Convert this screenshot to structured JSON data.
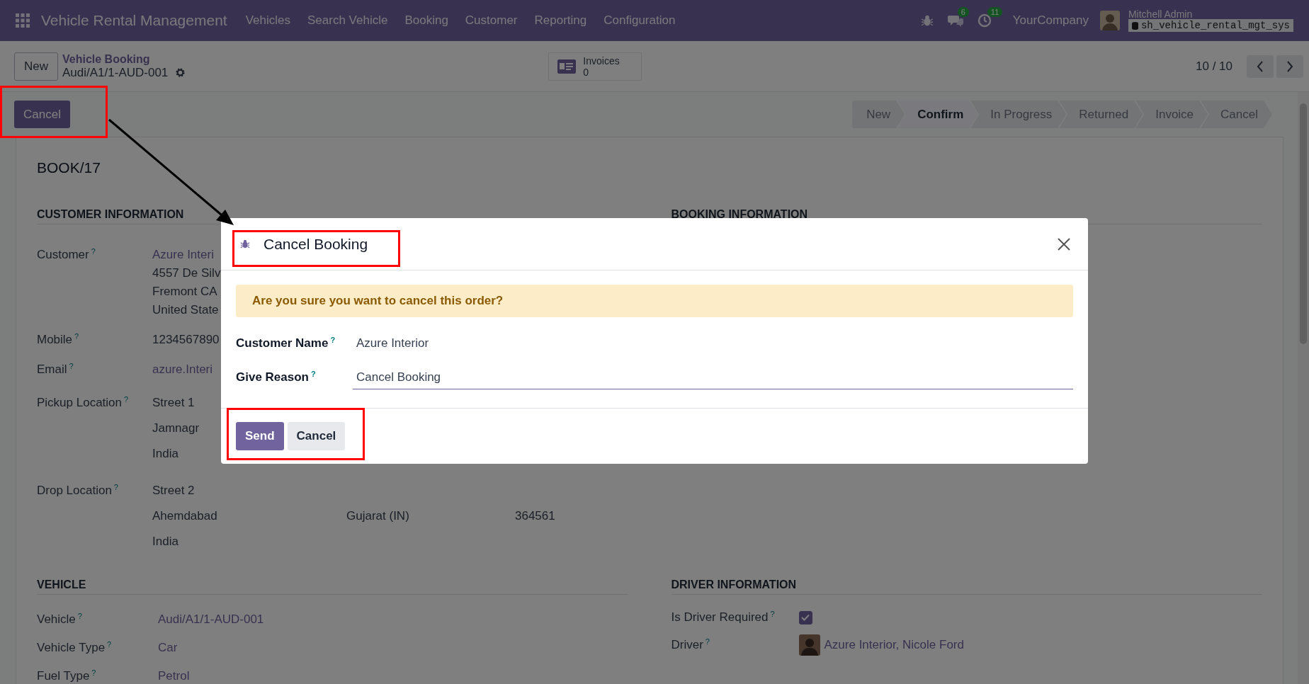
{
  "navbar": {
    "app_name": "Vehicle Rental Management",
    "menu": [
      "Vehicles",
      "Search Vehicle",
      "Booking",
      "Customer",
      "Reporting",
      "Configuration"
    ],
    "messages_badge": "6",
    "activities_badge": "11",
    "company": "YourCompany",
    "user": "Mitchell Admin",
    "database": "sh_vehicle_rental_mgt_sys"
  },
  "control_panel": {
    "new_button": "New",
    "breadcrumb": "Vehicle Booking",
    "record": "Audi/A1/1-AUD-001",
    "smart_button": {
      "label": "Invoices",
      "count": "0"
    },
    "pager": "10 / 10"
  },
  "cancel_button": "Cancel",
  "statusbar": [
    {
      "label": "New",
      "selected": false
    },
    {
      "label": "Confirm",
      "selected": true
    },
    {
      "label": "In Progress",
      "selected": false
    },
    {
      "label": "Returned",
      "selected": false
    },
    {
      "label": "Invoice",
      "selected": false
    },
    {
      "label": "Cancel",
      "selected": false
    }
  ],
  "form": {
    "reference": "BOOK/17",
    "customer_section": {
      "title": "CUSTOMER INFORMATION",
      "fields": [
        {
          "label": "Customer",
          "help": "?",
          "kind": "text",
          "link": true,
          "rows": [
            [
              "Azure Interi"
            ],
            [
              "4557 De Silv"
            ],
            [
              "Fremont CA"
            ],
            [
              "United State"
            ]
          ]
        },
        {
          "label": "Mobile",
          "help": "?",
          "kind": "text",
          "link": false,
          "rows": [
            [
              "1234567890"
            ]
          ]
        },
        {
          "label": "Email",
          "help": "?",
          "kind": "text",
          "link": true,
          "rows": [
            [
              "azure.Interi"
            ]
          ]
        },
        {
          "label": "Pickup Location",
          "help": "?",
          "kind": "address",
          "link": false,
          "rows": [
            [
              "Street 1"
            ],
            [
              "Jamnagr"
            ],
            [
              "India"
            ]
          ]
        },
        {
          "label": "Drop Location",
          "help": "?",
          "kind": "address",
          "link": false,
          "rows": [
            [
              "Street 2"
            ],
            [
              "Ahemdabad",
              "Gujarat (IN)",
              "364561"
            ],
            [
              "India"
            ]
          ]
        }
      ]
    },
    "booking_section": {
      "title": "BOOKING INFORMATION"
    },
    "vehicle_section": {
      "title": "VEHICLE",
      "fields": [
        {
          "label": "Vehicle",
          "help": "?",
          "value": "Audi/A1/1-AUD-001"
        },
        {
          "label": "Vehicle Type",
          "help": "?",
          "value": "Car"
        },
        {
          "label": "Fuel Type",
          "help": "?",
          "value": "Petrol"
        }
      ]
    },
    "driver_section": {
      "title": "DRIVER INFORMATION",
      "driver_required": {
        "label": "Is Driver Required",
        "help": "?",
        "checked": true
      },
      "driver": {
        "label": "Driver",
        "help": "?",
        "value": "Azure Interior, Nicole Ford"
      }
    }
  },
  "dialog": {
    "title": "Cancel Booking",
    "alert": "Are you sure you want to cancel this order?",
    "fields": [
      {
        "label": "Customer Name",
        "help": "?",
        "kind": "readonly",
        "value": "Azure Interior"
      },
      {
        "label": "Give Reason",
        "help": "?",
        "kind": "input",
        "value": "Cancel Booking"
      }
    ],
    "buttons": [
      {
        "label": "Send",
        "kind": "primary"
      },
      {
        "label": "Cancel",
        "kind": "secondary"
      }
    ]
  }
}
